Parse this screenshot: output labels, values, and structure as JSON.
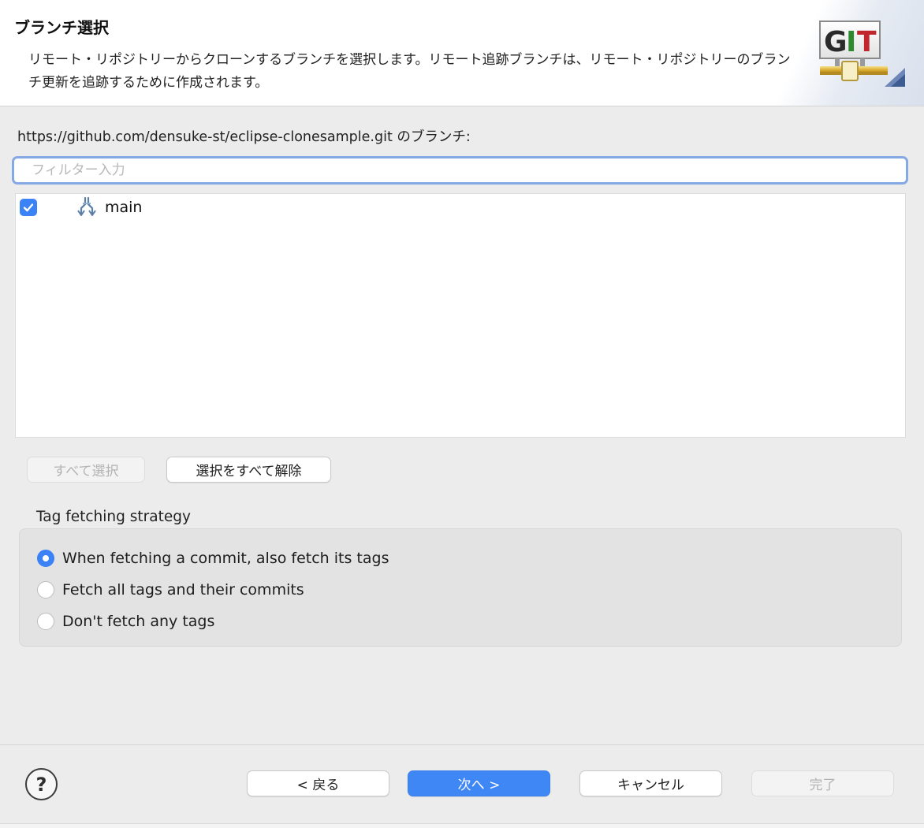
{
  "header": {
    "title": "ブランチ選択",
    "description": "リモート・リポジトリーからクローンするブランチを選択します。リモート追跡ブランチは、リモート・リポジトリーのブランチ更新を追跡するために作成されます。",
    "logo_text": "GIT",
    "logo_letters": [
      "G",
      "I",
      "T"
    ]
  },
  "branches": {
    "label": "https://github.com/densuke-st/eclipse-clonesample.git のブランチ:",
    "filter_placeholder": "フィルター入力",
    "filter_value": "",
    "items": [
      {
        "name": "main",
        "checked": true
      }
    ]
  },
  "selection_buttons": {
    "select_all": "すべて選択",
    "deselect_all": "選択をすべて解除"
  },
  "tag_strategy": {
    "title": "Tag fetching strategy",
    "options": [
      {
        "label": "When fetching a commit, also fetch its tags",
        "selected": true
      },
      {
        "label": "Fetch all tags and their commits",
        "selected": false
      },
      {
        "label": "Don't fetch any tags",
        "selected": false
      }
    ]
  },
  "footer": {
    "help": "?",
    "back": "< 戻る",
    "next": "次へ >",
    "cancel": "キャンセル",
    "finish": "完了"
  },
  "colors": {
    "accent": "#3a82f6",
    "primary_button": "#3f87f5",
    "logo_green": "#2f8a2f",
    "logo_red": "#c0262b"
  }
}
